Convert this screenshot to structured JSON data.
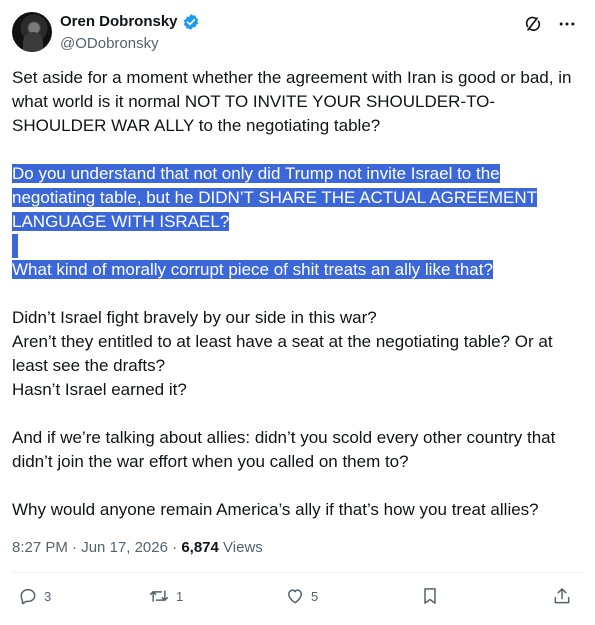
{
  "author": {
    "name": "Oren Dobronsky",
    "handle": "@ODobronsky"
  },
  "header": {
    "icons": [
      "grok-icon",
      "more-icon"
    ]
  },
  "post": {
    "p1": "Set aside for a moment whether the agreement with Iran is good or bad, in what world is it normal NOT TO INVITE YOUR SHOULDER-TO-SHOULDER WAR ALLY to the negotiating table?",
    "h1_line1": "Do you understand that not only did Trump not invite Israel to the",
    "h1_line2": "negotiating table, but he DIDN’T SHARE THE ACTUAL AGREEMENT",
    "h1_line3": "LANGUAGE WITH ISRAEL?",
    "h2": "What kind of morally corrupt piece of shit treats an ally like that?",
    "q1": "Didn’t Israel fight bravely by our side in this war?",
    "q2": "Aren’t they entitled to at least have a seat at the negotiating table? Or at least see the drafts?",
    "q3": "Hasn’t Israel earned it?",
    "p4": "And if we’re talking about allies: didn’t you scold every other country that didn’t join the war effort when you called on them to?",
    "p5": "Why would anyone remain America’s ally if that’s how you treat allies?"
  },
  "meta": {
    "time": "8:27 PM",
    "separator": "·",
    "date": "Jun 17, 2026",
    "views_count": "6,874",
    "views_label": "Views"
  },
  "actions": {
    "replies": "3",
    "reposts": "1",
    "likes": "5"
  },
  "colors": {
    "highlight": "#3b67d8",
    "verified": "#1d9bf0",
    "muted": "#536471"
  }
}
